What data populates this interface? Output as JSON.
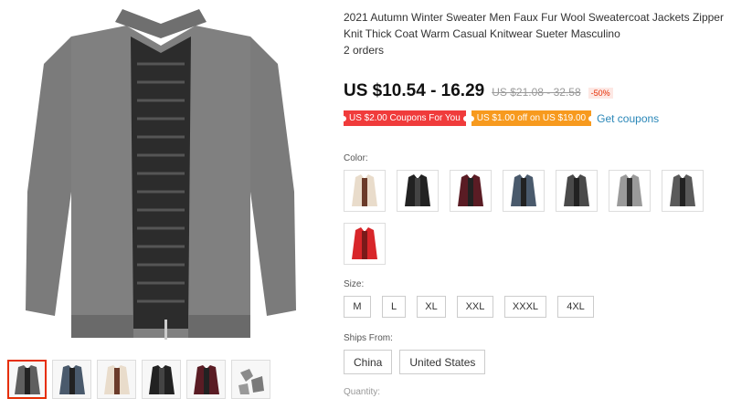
{
  "product": {
    "title": "2021 Autumn Winter Sweater Men Faux Fur Wool Sweatercoat Jackets Zipper Knit Thick Coat Warm Casual Knitwear Sueter Masculino",
    "orders": "2 orders",
    "price": "US $10.54 - 16.29",
    "old_price": "US $21.08 - 32.58",
    "discount": "-50%"
  },
  "coupons": {
    "store_coupon": "US $2.00 Coupons For You",
    "select_coupon": "US $1.00 off on US $19.00",
    "get_coupons_link": "Get coupons"
  },
  "color": {
    "label": "Color:",
    "options": [
      {
        "name": "beige",
        "hex": "#e9dccb"
      },
      {
        "name": "black",
        "hex": "#222222"
      },
      {
        "name": "wine-red",
        "hex": "#5a1c24"
      },
      {
        "name": "blue-gray",
        "hex": "#4a5a6c"
      },
      {
        "name": "dark-gray",
        "hex": "#4a4a4a"
      },
      {
        "name": "light-gray",
        "hex": "#9a9a9a"
      },
      {
        "name": "charcoal",
        "hex": "#5a5a5a"
      },
      {
        "name": "red",
        "hex": "#d8262a"
      }
    ]
  },
  "size": {
    "label": "Size:",
    "options": [
      "M",
      "L",
      "XL",
      "XXL",
      "XXXL",
      "4XL"
    ]
  },
  "ships_from": {
    "label": "Ships From:",
    "options": [
      "China",
      "United States"
    ]
  },
  "quantity": {
    "label": "Quantity:"
  },
  "gallery": {
    "main_color": "#7b7b7b",
    "thumbnails": [
      "#5f5f5f",
      "#4a5a6c",
      "#e9dccb",
      "#222222",
      "#5a1c24",
      "#8a8a8a"
    ]
  }
}
